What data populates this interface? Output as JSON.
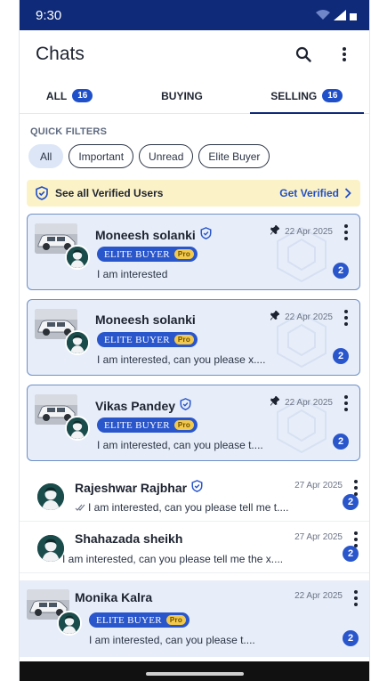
{
  "status": {
    "time": "9:30"
  },
  "header": {
    "title": "Chats",
    "search_icon": "search-icon",
    "menu_icon": "more-vert-icon"
  },
  "tabs": [
    {
      "label": "ALL",
      "count": "16"
    },
    {
      "label": "BUYING",
      "count": ""
    },
    {
      "label": "SELLING",
      "count": "16",
      "active": true
    }
  ],
  "quick_filters": {
    "title": "QUICK FILTERS",
    "chips": [
      "All",
      "Important",
      "Unread",
      "Elite Buyer"
    ],
    "selected": "All"
  },
  "banner": {
    "text": "See all Verified Users",
    "action": "Get Verified"
  },
  "badge": {
    "elite": "ELITE BUYER",
    "pro": "Pro"
  },
  "chats": [
    {
      "name": "Moneesh solanki",
      "verified": true,
      "pinned": true,
      "date": "22 Apr 2025",
      "message": "I am interested",
      "unread": "2",
      "elite": true
    },
    {
      "name": "Moneesh solanki",
      "verified": false,
      "pinned": true,
      "date": "22 Apr 2025",
      "message": "I am interested, can you please x....",
      "unread": "2",
      "elite": true
    },
    {
      "name": "Vikas Pandey",
      "verified": true,
      "pinned": true,
      "date": "22 Apr 2025",
      "message": "I am interested, can you please t....",
      "unread": "2",
      "elite": true
    },
    {
      "name": "Rajeshwar Rajbhar",
      "verified": true,
      "pinned": false,
      "date": "27 Apr 2025",
      "message": "I am interested, can you please tell me t....",
      "unread": "2",
      "elite": false
    },
    {
      "name": "Shahazada sheikh",
      "verified": false,
      "pinned": false,
      "date": "27 Apr 2025",
      "message": "I am interested, can you please tell me the x....",
      "unread": "2",
      "elite": false
    },
    {
      "name": "Monika Kalra",
      "verified": false,
      "pinned": false,
      "date": "22 Apr 2025",
      "message": "I am interested, can you please t....",
      "unread": "2",
      "elite": true
    }
  ],
  "colors": {
    "primary": "#0f2a78",
    "accent": "#2a56cc",
    "card_bg": "#e7eef9",
    "banner_bg": "#fcf2c7"
  }
}
